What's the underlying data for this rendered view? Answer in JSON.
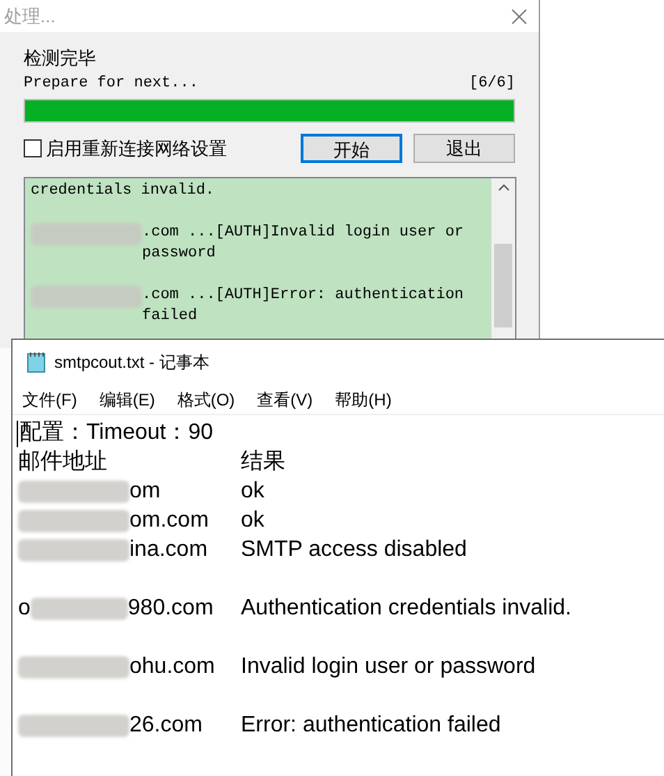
{
  "dialog": {
    "title": "处理...",
    "status": "检测完毕",
    "progress_text": "Prepare for next...",
    "progress_count": "[6/6]",
    "progress": {
      "level": 1
    },
    "checkbox": {
      "label": "启用重新连接网络设置",
      "checked": false
    },
    "buttons": [
      {
        "label": "开始",
        "focused": true
      },
      {
        "label": "退出",
        "focused": false
      }
    ],
    "log": [
      {
        "text": "credentials invalid.",
        "redacted": false
      },
      {
        "text": ".com ...[AUTH]Invalid login user or password",
        "redacted": true
      },
      {
        "text": ".com ...[AUTH]Error: authentication failed",
        "redacted": true
      }
    ]
  },
  "notepad": {
    "title": "smtpcout.txt - 记事本",
    "menu": [
      "文件(F)",
      "编辑(E)",
      "格式(O)",
      "查看(V)",
      "帮助(H)"
    ],
    "config_line": "配置：Timeout：90",
    "columns": [
      "邮件地址",
      "结果"
    ],
    "rows": [
      {
        "prefix": "",
        "address": "om",
        "result": "ok",
        "spaced": false
      },
      {
        "prefix": "",
        "address": "om.com",
        "result": "ok",
        "spaced": false
      },
      {
        "prefix": "",
        "address": "ina.com",
        "result": "SMTP access disabled",
        "spaced": false
      },
      {
        "prefix": "o",
        "address": "980.com",
        "result": "Authentication credentials invalid.",
        "spaced": true
      },
      {
        "prefix": "",
        "address": "ohu.com",
        "result": "Invalid login user or password",
        "spaced": true
      },
      {
        "prefix": "",
        "address": "26.com",
        "result": "Error: authentication failed",
        "spaced": true
      }
    ]
  }
}
